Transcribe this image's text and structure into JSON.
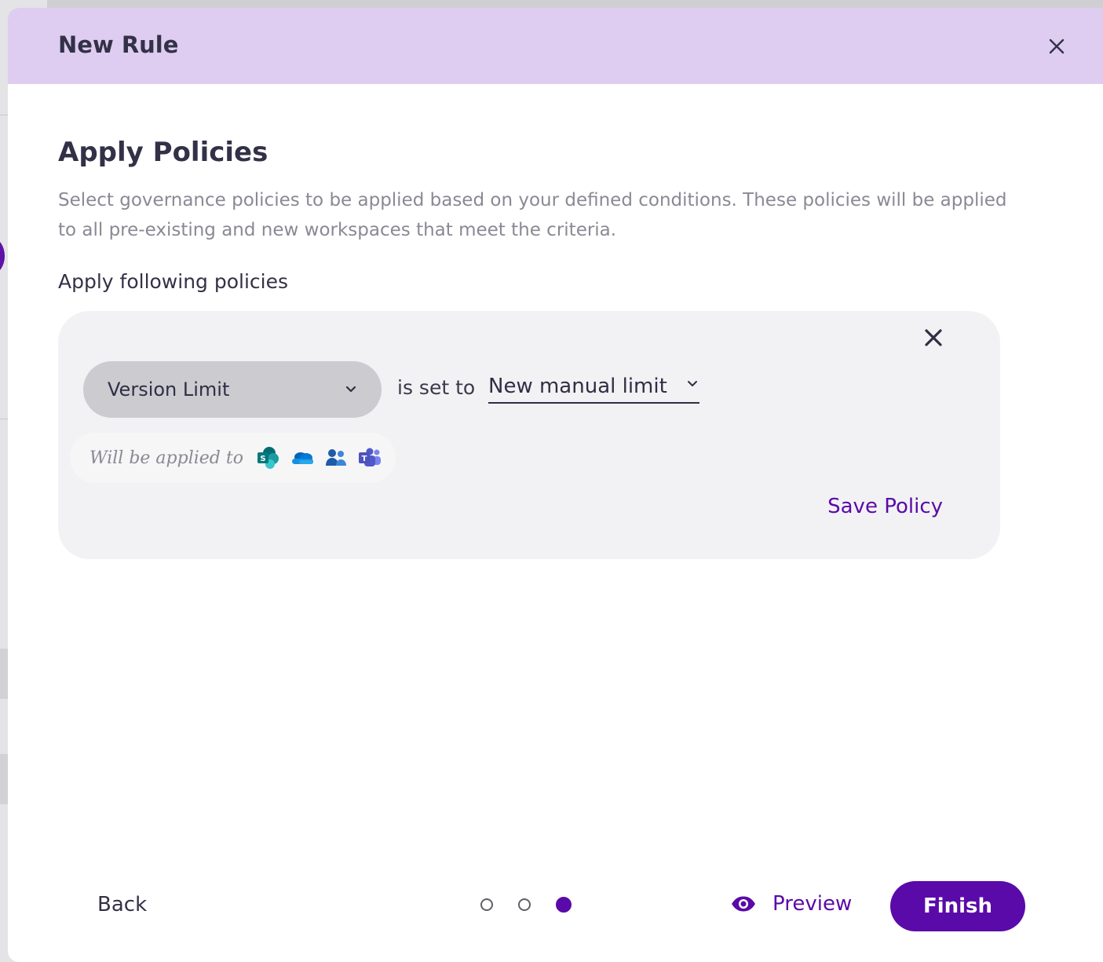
{
  "modal": {
    "title": "New Rule"
  },
  "section": {
    "title": "Apply Policies",
    "description": "Select governance policies to be applied based on your defined conditions. These policies will be applied to all pre-existing and new workspaces that meet the criteria.",
    "sub_label": "Apply following policies"
  },
  "policy": {
    "name": "Version Limit",
    "connector": "is set to",
    "value": "New manual limit",
    "applied_to_label": "Will be applied to",
    "applied_apps": [
      "sharepoint-icon",
      "onedrive-icon",
      "groups-icon",
      "teams-icon"
    ],
    "save_label": "Save Policy"
  },
  "footer": {
    "back_label": "Back",
    "steps_total": 3,
    "current_step": 3,
    "preview_label": "Preview",
    "finish_label": "Finish"
  },
  "colors": {
    "header_bg": "#decdf0",
    "accent": "#5a0aa8",
    "card_bg": "#f2f2f4",
    "select_bg": "#cbcbd0"
  }
}
